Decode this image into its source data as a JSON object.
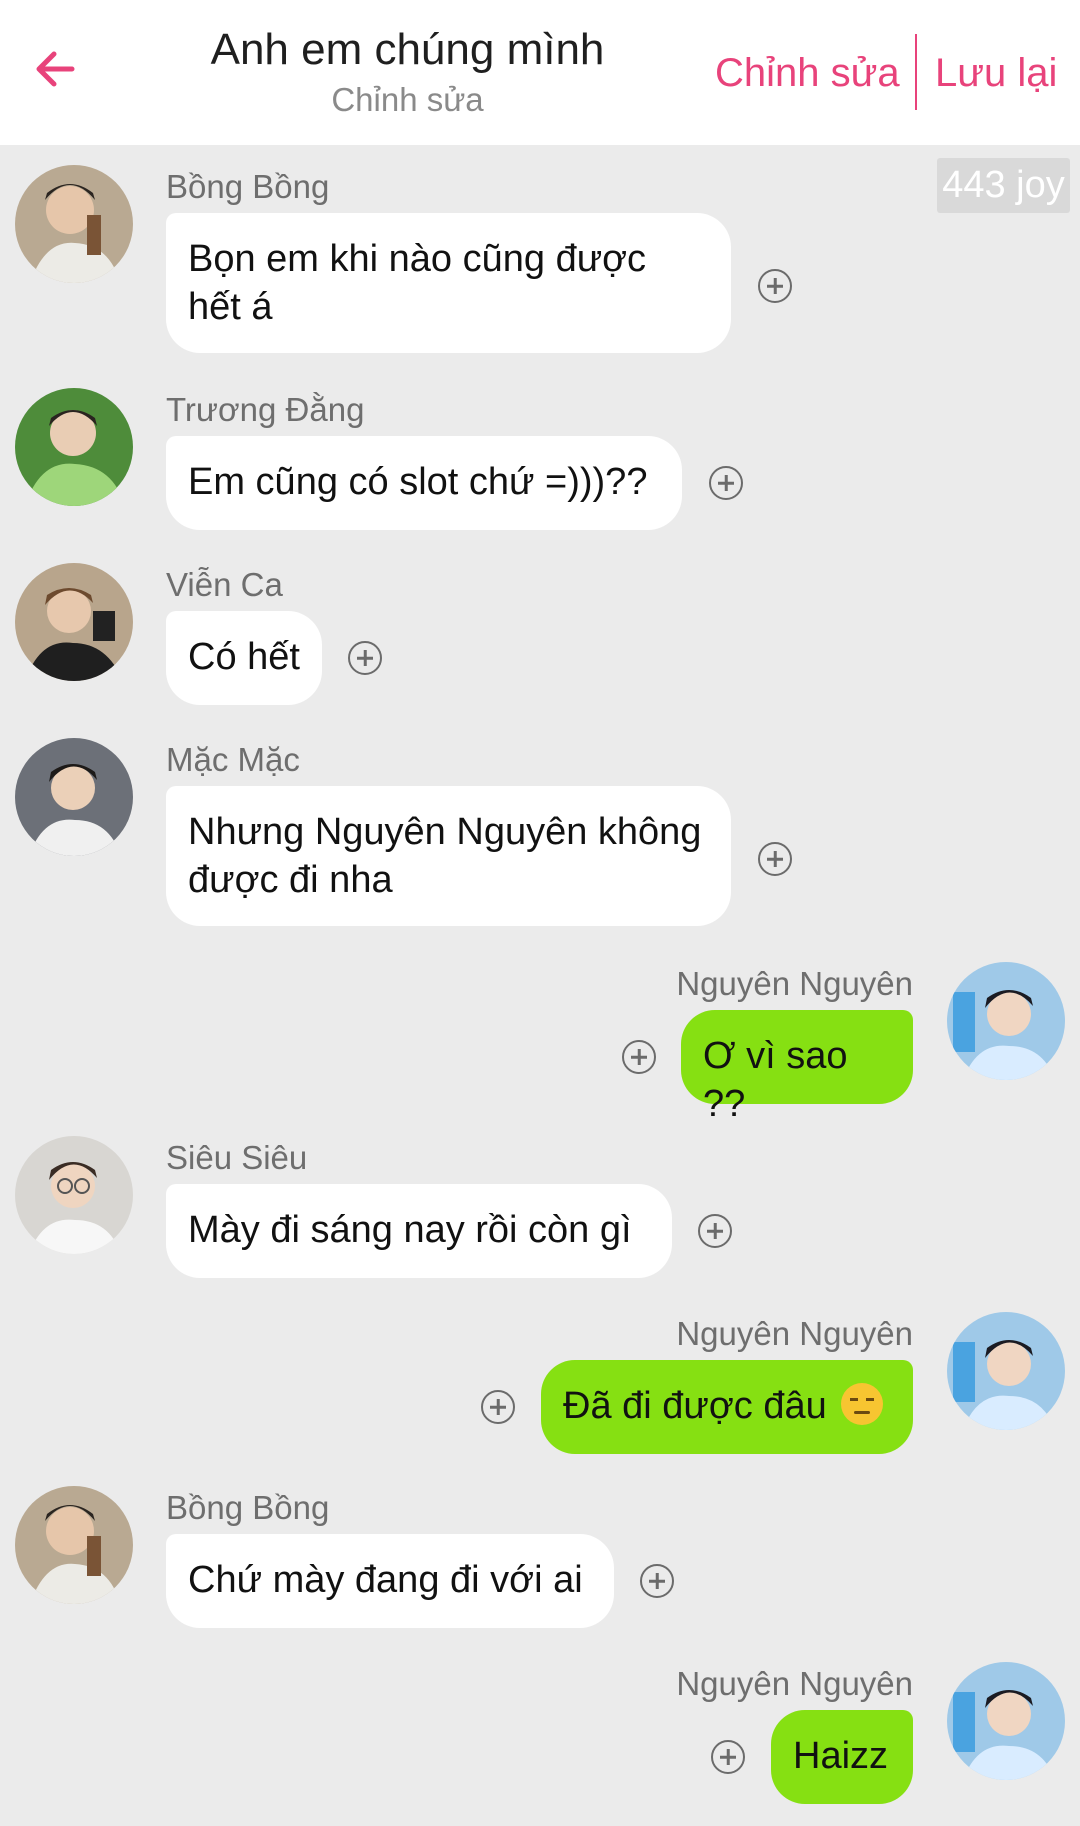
{
  "header": {
    "title": "Anh em chúng mình",
    "subtitle": "Chỉnh sửa",
    "edit_label": "Chỉnh sửa",
    "save_label": "Lưu lại",
    "back_icon": "arrow-left-icon",
    "accent_color": "#e8437b"
  },
  "badge": {
    "text": "443 joy"
  },
  "messages": [
    {
      "sender": "Bồng Bồng",
      "text": "Bọn em khi nào cũng được hết á",
      "side": "left"
    },
    {
      "sender": "Trương Đằng",
      "text": "Em cũng có slot chứ =)))??",
      "side": "left"
    },
    {
      "sender": "Viễn Ca",
      "text": "Có hết",
      "side": "left"
    },
    {
      "sender": "Mặc Mặc",
      "text": "Nhưng Nguyên Nguyên không được đi nha",
      "side": "left"
    },
    {
      "sender": "Nguyên Nguyên",
      "text": "Ơ vì sao ??",
      "side": "right"
    },
    {
      "sender": "Siêu Siêu",
      "text": "Mày đi sáng nay rồi còn gì",
      "side": "left"
    },
    {
      "sender": "Nguyên Nguyên",
      "text": "Đã đi được đâu",
      "emoji": "pensive-face-icon",
      "side": "right"
    },
    {
      "sender": "Bồng Bồng",
      "text": "Chứ mày đang đi với ai",
      "side": "left"
    },
    {
      "sender": "Nguyên Nguyên",
      "text": "Haizz",
      "side": "right"
    }
  ],
  "colors": {
    "background": "#ebebeb",
    "incoming_bubble": "#ffffff",
    "outgoing_bubble": "#86e012"
  }
}
